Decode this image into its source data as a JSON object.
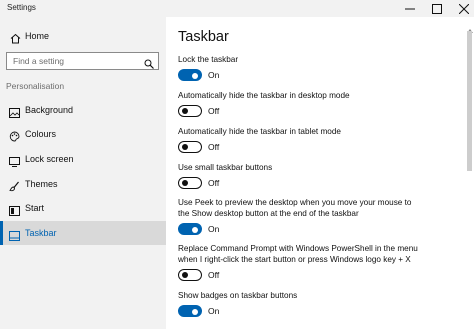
{
  "window": {
    "title": "Settings"
  },
  "sidebar": {
    "home_label": "Home",
    "search_placeholder": "Find a setting",
    "section_label": "Personalisation",
    "items": [
      {
        "label": "Background",
        "icon": "image-icon",
        "active": false
      },
      {
        "label": "Colours",
        "icon": "palette-icon",
        "active": false
      },
      {
        "label": "Lock screen",
        "icon": "lock-screen-icon",
        "active": false
      },
      {
        "label": "Themes",
        "icon": "brush-icon",
        "active": false
      },
      {
        "label": "Start",
        "icon": "start-icon",
        "active": false
      },
      {
        "label": "Taskbar",
        "icon": "taskbar-icon",
        "active": true
      }
    ]
  },
  "main": {
    "title": "Taskbar",
    "settings": [
      {
        "label": "Lock the taskbar",
        "state": "On",
        "on": true
      },
      {
        "label": "Automatically hide the taskbar in desktop mode",
        "state": "Off",
        "on": false
      },
      {
        "label": "Automatically hide the taskbar in tablet mode",
        "state": "Off",
        "on": false
      },
      {
        "label": "Use small taskbar buttons",
        "state": "Off",
        "on": false
      },
      {
        "label": "Use Peek to preview the desktop when you move your mouse to\nthe Show desktop button at the end of the taskbar",
        "state": "On",
        "on": true
      },
      {
        "label": "Replace Command Prompt with Windows PowerShell in the menu\nwhen I right-click the start button or press Windows logo key + X",
        "state": "Off",
        "on": false
      },
      {
        "label": "Show badges on taskbar buttons",
        "state": "On",
        "on": true
      }
    ]
  },
  "colors": {
    "accent": "#0063b1",
    "sidebar_bg": "#f2f2f2",
    "active_item_bg": "#d9d9d9"
  }
}
